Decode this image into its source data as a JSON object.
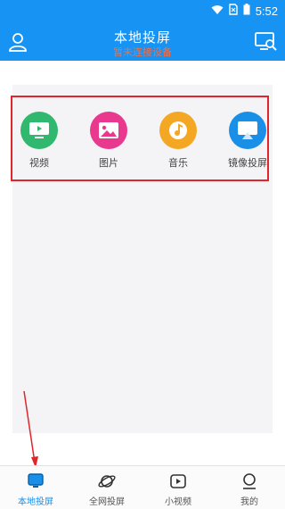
{
  "status_bar": {
    "time": "5:52"
  },
  "header": {
    "title": "本地投屏",
    "subtitle": "暂未连接设备"
  },
  "apps": [
    {
      "label": "视频",
      "color": "#2fb86e"
    },
    {
      "label": "图片",
      "color": "#e8398f"
    },
    {
      "label": "音乐",
      "color": "#f3a722"
    },
    {
      "label": "镜像投屏",
      "color": "#1a8fe8"
    }
  ],
  "bottom_nav": [
    {
      "label": "本地投屏",
      "active": true
    },
    {
      "label": "全网投屏",
      "active": false
    },
    {
      "label": "小视频",
      "active": false
    },
    {
      "label": "我的",
      "active": false
    }
  ],
  "colors": {
    "brand": "#1793f3",
    "subtitle": "#ff6a3a",
    "highlight_box": "#e2252b"
  }
}
